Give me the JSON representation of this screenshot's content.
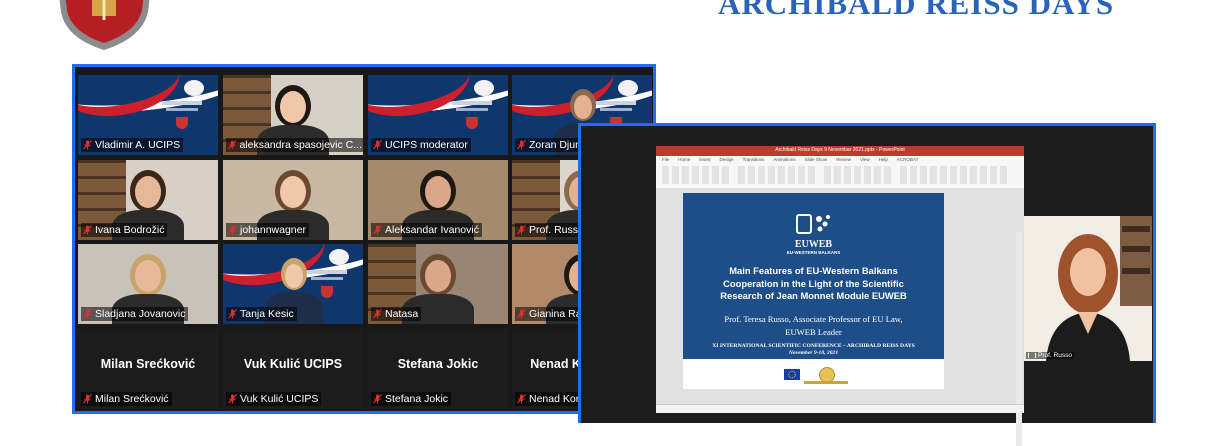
{
  "header": {
    "conference_title": "ARCHIBALD REISS DAYS"
  },
  "gallery": {
    "tiles": [
      {
        "name": "Vladimir A. UCIPS",
        "kind": "banner"
      },
      {
        "name": "aleksandra spasojevic C...",
        "kind": "person"
      },
      {
        "name": "UCIPS moderator",
        "kind": "banner"
      },
      {
        "name": "Zoran Djurdjevic",
        "kind": "banner-person"
      },
      {
        "name": "Ivana Bodrožić",
        "kind": "person"
      },
      {
        "name": "johannwagner",
        "kind": "person"
      },
      {
        "name": "Aleksandar Ivanović",
        "kind": "person"
      },
      {
        "name": "Prof. Russo",
        "kind": "person",
        "active": true
      },
      {
        "name": "Sladjana Jovanovic",
        "kind": "person"
      },
      {
        "name": "Tanja Kesic",
        "kind": "banner-person"
      },
      {
        "name": "Natasa",
        "kind": "person"
      },
      {
        "name": "Gianina Radu",
        "kind": "person"
      },
      {
        "name": "Milan Srećković",
        "display": "Milan Srećković",
        "kind": "name"
      },
      {
        "name": "Vuk Kulić UCIPS",
        "display": "Vuk Kulić UCIPS",
        "kind": "name"
      },
      {
        "name": "Stefana Jokic",
        "display": "Stefana Jokic",
        "kind": "name"
      },
      {
        "name": "Nenad Koropanovski",
        "display": "Nenad  Koropan...",
        "kind": "name"
      }
    ]
  },
  "presentation": {
    "window_title": "Archibald Reiss Days 9 Novembar 2021.pptx - PowerPoint",
    "ribbon_tabs": [
      "File",
      "Home",
      "Insert",
      "Design",
      "Transitions",
      "Animations",
      "Slide Show",
      "Review",
      "View",
      "Help",
      "ACROBAT"
    ],
    "logo_name": "EUWEB",
    "logo_sub": "EU-WESTERN BALKANS",
    "title_lines": [
      "Main Features of EU-Western Balkans",
      "Cooperation in the Light of the Scientific",
      "Research of Jean Monnet Module EUWEB"
    ],
    "author_lines": [
      "Prof. Teresa Russo, Associate Professor of EU Law,",
      "EUWEB Leader"
    ],
    "conference": "XI INTERNATIONAL SCIENTIFIC CONFERENCE – ARCHIBALD REISS DAYS",
    "date": "November 9-10, 2021"
  },
  "presenter": {
    "name": "Prof. Russo"
  },
  "colors": {
    "accent": "#1f6cf5",
    "title_blue": "#2a64b8",
    "slide_blue": "#1d4e89",
    "muted_mic": "#e02f2f"
  }
}
